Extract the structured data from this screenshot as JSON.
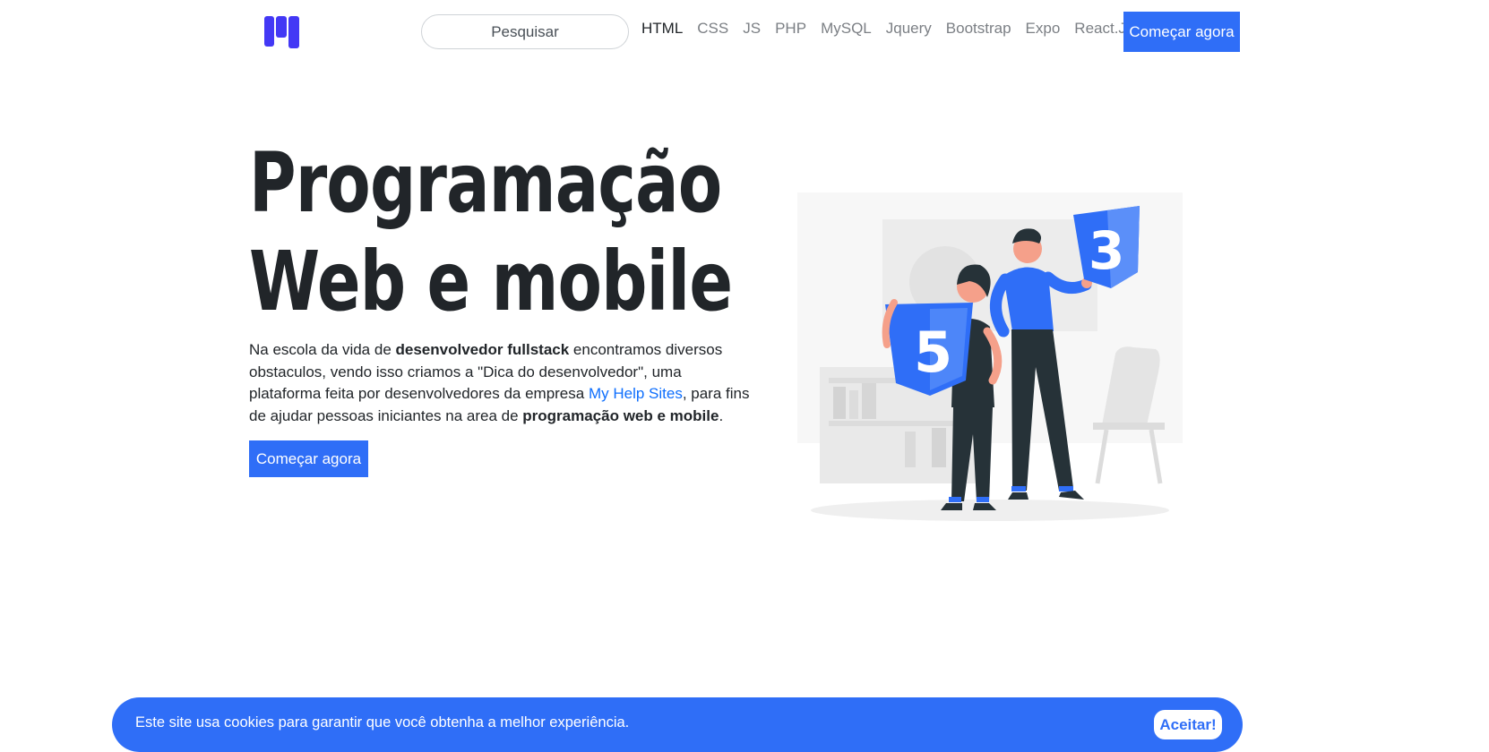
{
  "navbar": {
    "logo_icon": "brand-logo-icon",
    "search_placeholder": "Pesquisar",
    "links": [
      {
        "label": "HTML",
        "active": true
      },
      {
        "label": "CSS",
        "active": false
      },
      {
        "label": "JS",
        "active": false
      },
      {
        "label": "PHP",
        "active": false
      },
      {
        "label": "MySQL",
        "active": false
      },
      {
        "label": "Jquery",
        "active": false
      },
      {
        "label": "Bootstrap",
        "active": false
      },
      {
        "label": "Expo",
        "active": false
      },
      {
        "label": "React.Js",
        "active": false
      }
    ],
    "cta_label": "Começar agora"
  },
  "hero": {
    "title_line1": "Programação",
    "title_line2": "Web e mobile",
    "text": {
      "p1": "Na escola da vida de ",
      "b1": "desenvolvedor fullstack",
      "p2": " encontramos diversos obstaculos, vendo isso criamos a \"Dica do desenvolvedor\", uma plataforma feita por desenvolvedores da empresa ",
      "link": "My Help Sites",
      "p3": ", para fins de ajudar pessoas iniciantes na area de ",
      "b2": "programação web e mobile",
      "p4": "."
    },
    "cta_label": "Começar agora",
    "illustration": {
      "html_badge": "5",
      "css_badge": "3"
    }
  },
  "cookie_banner": {
    "text": "Este site usa cookies para garantir que você obtenha a melhor experiência.",
    "button_label": "Aceitar!"
  },
  "colors": {
    "accent": "#2f6ef7",
    "link": "#0d6efd",
    "text": "#212529",
    "nav_inactive": "#7b7f84"
  }
}
